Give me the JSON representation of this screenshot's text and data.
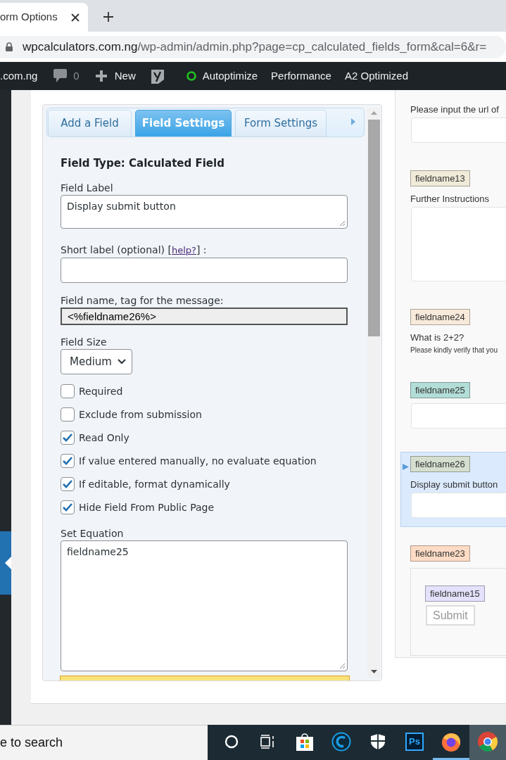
{
  "browser": {
    "tab_title": "orm Options",
    "address": {
      "host": "wpcalculators.com.ng",
      "path": "/wp-admin/admin.php?page=cp_calculated_fields_form&cal=6&r="
    }
  },
  "admin_bar": {
    "site": ".com.ng",
    "comments": "0",
    "new": "New",
    "items": [
      {
        "label": "Autoptimize",
        "status": true
      },
      {
        "label": "Performance",
        "status": false
      },
      {
        "label": "A2 Optimized",
        "status": false
      }
    ]
  },
  "settings": {
    "tabs": [
      {
        "label": "Add a Field",
        "selected": false
      },
      {
        "label": "Field Settings",
        "selected": true
      },
      {
        "label": "Form Settings",
        "selected": false
      }
    ],
    "field_type": "Field Type: Calculated Field",
    "fields": [
      {
        "kind": "textarea",
        "label": "Field Label",
        "value": "Display submit button"
      },
      {
        "kind": "input",
        "label": "Short label (optional) [",
        "link": "help?",
        "label_end": "] :"
      },
      {
        "kind": "readonly",
        "label": "Field name, tag for the message:",
        "value": "<%fieldname26%>"
      },
      {
        "kind": "select",
        "label": "Field Size",
        "value": "Medium"
      }
    ],
    "checkboxes": [
      {
        "label": "Required",
        "checked": false
      },
      {
        "label": "Exclude from submission",
        "checked": false
      },
      {
        "label": "Read Only",
        "checked": true
      },
      {
        "label": "If value entered manually, no evaluate equation",
        "checked": true
      },
      {
        "label": "If editable, format dynamically",
        "checked": true
      },
      {
        "label": "Hide Field From Public Page",
        "checked": true
      }
    ],
    "equation": {
      "label": "Set Equation",
      "value": "fieldname25"
    }
  },
  "preview": {
    "items": [
      {
        "kind": "input",
        "label": "Please input the url of",
        "selected": false
      },
      {
        "kind": "textarea",
        "tag": "fieldname13",
        "color": "#f0ebd8",
        "label": "Further Instructions",
        "selected": false
      },
      {
        "kind": "text",
        "tag": "fieldname24",
        "color": "#f8eadb",
        "label": "What is 2+2?",
        "note": "Please kindly verify that you",
        "selected": false
      },
      {
        "kind": "input",
        "tag": "fieldname25",
        "color": "#b3ded7",
        "selected": false
      },
      {
        "kind": "input",
        "tag": "fieldname26",
        "color": "#d5dfd0",
        "label": "Display submit button",
        "selected": true
      },
      {
        "kind": "container",
        "tag": "fieldname23",
        "color": "#fddbc4",
        "selected": false,
        "children": [
          {
            "kind": "button",
            "tag": "fieldname15",
            "color": "#e3e1fb",
            "button": "Submit"
          }
        ]
      }
    ]
  },
  "taskbar": {
    "search": "e to search",
    "apps": [
      {
        "kind": "cortana",
        "running": false,
        "active": false
      },
      {
        "kind": "taskview",
        "running": false,
        "active": false
      },
      {
        "kind": "store",
        "running": false,
        "active": false
      },
      {
        "kind": "cleaner",
        "running": false,
        "active": false
      },
      {
        "kind": "shield",
        "running": false,
        "active": false
      },
      {
        "kind": "ps",
        "label": "Ps",
        "running": false,
        "active": false
      },
      {
        "kind": "firefox",
        "running": true,
        "active": false
      },
      {
        "kind": "chrome",
        "running": false,
        "active": true
      }
    ]
  }
}
